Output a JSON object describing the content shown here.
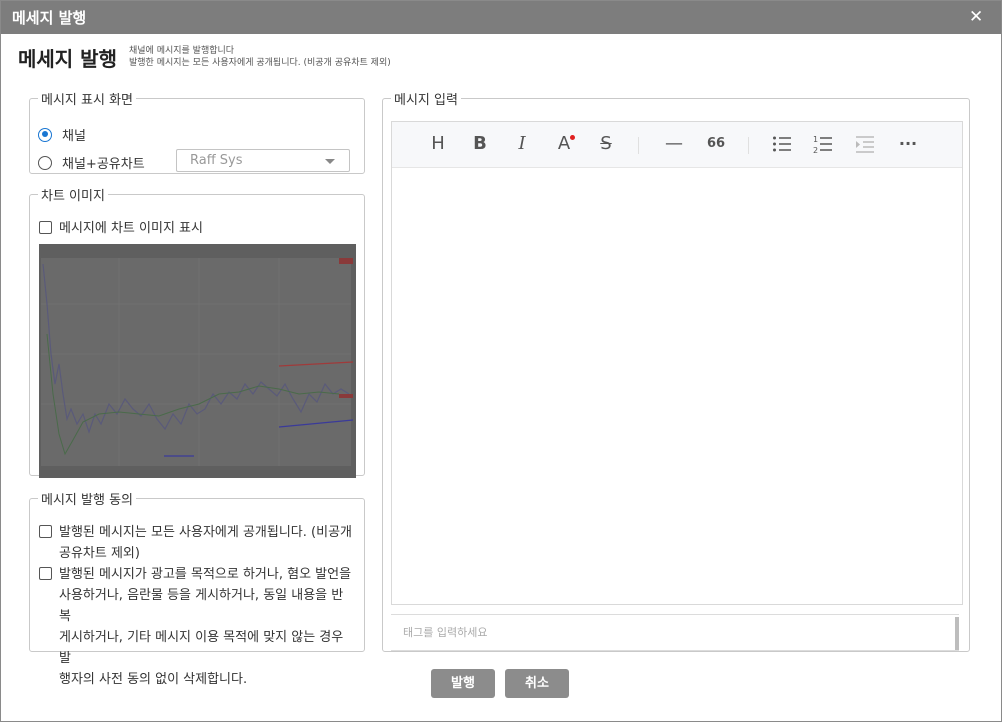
{
  "window": {
    "title": "메세지 발행",
    "close_icon": "close-icon"
  },
  "header": {
    "title": "메세지 발행",
    "subtitle_line1": "채널에 메시지를 발행합니다",
    "subtitle_line2": "발행한 메시지는 모든 사용자에게 공개됩니다. (비공개 공유차트 제외)"
  },
  "display": {
    "legend": "메시지 표시 화면",
    "option_channel": "채널",
    "option_channel_chart": "채널+공유차트",
    "selected": "채널",
    "chart_select_value": "Raff Sys"
  },
  "chart_image": {
    "legend": "차트 이미지",
    "checkbox_label": "메시지에 차트 이미지 표시",
    "checked": false
  },
  "consent": {
    "legend": "메시지 발행 동의",
    "item1_line1": "발행된 메시지는 모든 사용자에게 공개됩니다. (비공개",
    "item1_line2": "공유차트 제외)",
    "item2_line1": "발행된 메시지가 광고를 목적으로 하거나, 혐오 발언을",
    "item2_line2": "사용하거나, 음란물 등을 게시하거나, 동일 내용을 반복",
    "item2_line3": "게시하거나, 기타 메시지 이용 목적에 맞지 않는 경우 발",
    "item2_line4": "행자의 사전 동의 없이 삭제합니다."
  },
  "message_input": {
    "legend": "메시지 입력",
    "toolbar": {
      "heading": "H",
      "bold": "B",
      "italic": "I",
      "font_color": "A",
      "strike": "S",
      "hr": "—",
      "quote": "66",
      "more": "···"
    },
    "tag_placeholder": "태그를 입력하세요"
  },
  "buttons": {
    "publish": "발행",
    "cancel": "취소"
  },
  "colors": {
    "titlebar": "#7d7d7d",
    "accent": "#1976d2",
    "button": "#8c8c8c"
  }
}
